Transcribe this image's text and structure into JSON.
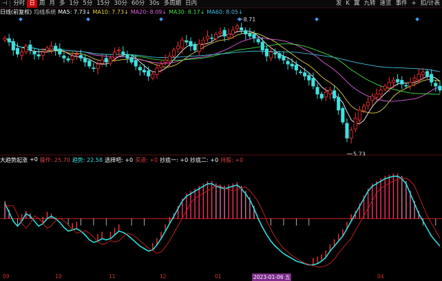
{
  "toolbar": {
    "items": [
      "分时",
      "日",
      "周",
      "月",
      "多",
      "1分",
      "5分",
      "15分",
      "30分",
      "60分",
      "30s",
      "多周期",
      "日内"
    ],
    "active_index": 1,
    "prev_label": "⊣",
    "right_items": [
      "发",
      "K",
      "翼",
      "九转",
      "速览",
      "事件",
      "+",
      "扣/计表"
    ]
  },
  "main_panel": {
    "mode_label": "日线(前复权)",
    "indicator_name": "均线系统",
    "ma": [
      {
        "label": "MA5: 7.73↓",
        "color": "#ffffff"
      },
      {
        "label": "MA10: 7.73↓",
        "color": "#e8d040"
      },
      {
        "label": "MA20: 8.09↓",
        "color": "#e060e0"
      },
      {
        "label": "MA30: 8.17↓",
        "color": "#40e040"
      },
      {
        "label": "MA60: 8.05↓",
        "color": "#40c0e0"
      }
    ],
    "high_label": "8.71",
    "low_label": "5.73"
  },
  "sub_panel": {
    "indicator_name": "大趋势起涨",
    "items": [
      {
        "label": "+0",
        "color": "#ffffff"
      },
      {
        "label": "操作: 25.70",
        "color": "#e04040"
      },
      {
        "label": "趋势: 22.58",
        "color": "#40e0e0"
      },
      {
        "label": "选择吧: +0",
        "color": "#ffffff"
      },
      {
        "label": "买进: +0",
        "color": "#e04040"
      },
      {
        "label": "抄底一: +0",
        "color": "#ffffff"
      },
      {
        "label": "抄底二: +0",
        "color": "#ffffff"
      },
      {
        "label": "持股: +0",
        "color": "#e04040"
      }
    ]
  },
  "date_axis": {
    "labels": [
      "09",
      "10",
      "11",
      "12",
      "01",
      "2023-01-06 五",
      "04"
    ],
    "highlight_index": 5
  },
  "chart_data": {
    "type": "candlestick",
    "close": [
      8.4,
      8.3,
      8.1,
      8.0,
      8.05,
      8.2,
      8.1,
      8.0,
      7.95,
      8.05,
      8.15,
      8.2,
      8.1,
      8.0,
      7.9,
      7.85,
      7.95,
      8.0,
      7.9,
      7.8,
      7.7,
      7.65,
      7.75,
      7.85,
      7.8,
      7.9,
      8.05,
      8.1,
      8.0,
      7.9,
      7.8,
      7.7,
      7.6,
      7.55,
      7.45,
      7.5,
      7.65,
      7.75,
      7.85,
      7.95,
      8.1,
      8.2,
      8.35,
      8.3,
      8.2,
      8.1,
      8.25,
      8.35,
      8.45,
      8.4,
      8.5,
      8.55,
      8.45,
      8.5,
      8.6,
      8.7,
      8.6,
      8.5,
      8.45,
      8.4,
      8.3,
      8.1,
      7.95,
      8.05,
      8.0,
      7.9,
      7.85,
      7.75,
      7.7,
      7.6,
      7.55,
      7.45,
      7.35,
      7.2,
      7.0,
      6.9,
      7.05,
      7.1,
      6.9,
      6.6,
      6.3,
      5.9,
      6.1,
      6.4,
      6.6,
      6.7,
      6.8,
      6.95,
      7.0,
      7.1,
      7.2,
      7.3,
      7.35,
      7.3,
      7.25,
      7.2,
      7.3,
      7.4,
      7.5,
      7.55,
      7.45,
      7.3,
      7.2,
      7.1
    ],
    "price_range": [
      5.6,
      8.8
    ],
    "trend": [
      52,
      45,
      38,
      34,
      38,
      44,
      42,
      38,
      34,
      36,
      40,
      42,
      40,
      37,
      33,
      30,
      31,
      32,
      30,
      27,
      23,
      21,
      22,
      24,
      23,
      24,
      27,
      30,
      29,
      27,
      24,
      21,
      18,
      16,
      14,
      15,
      19,
      24,
      30,
      36,
      42,
      48,
      54,
      58,
      60,
      62,
      64,
      66,
      68,
      68,
      66,
      65,
      64,
      65,
      66,
      67,
      64,
      60,
      55,
      48,
      40,
      33,
      27,
      22,
      18,
      15,
      12,
      10,
      8,
      6,
      5,
      4,
      3,
      3,
      4,
      6,
      9,
      14,
      18,
      22,
      26,
      32,
      38,
      44,
      50,
      56,
      62,
      66,
      68,
      70,
      72,
      73,
      74,
      74,
      72,
      68,
      60,
      52,
      44,
      38,
      32,
      26,
      22,
      18
    ],
    "trend_range": [
      0,
      80
    ]
  }
}
